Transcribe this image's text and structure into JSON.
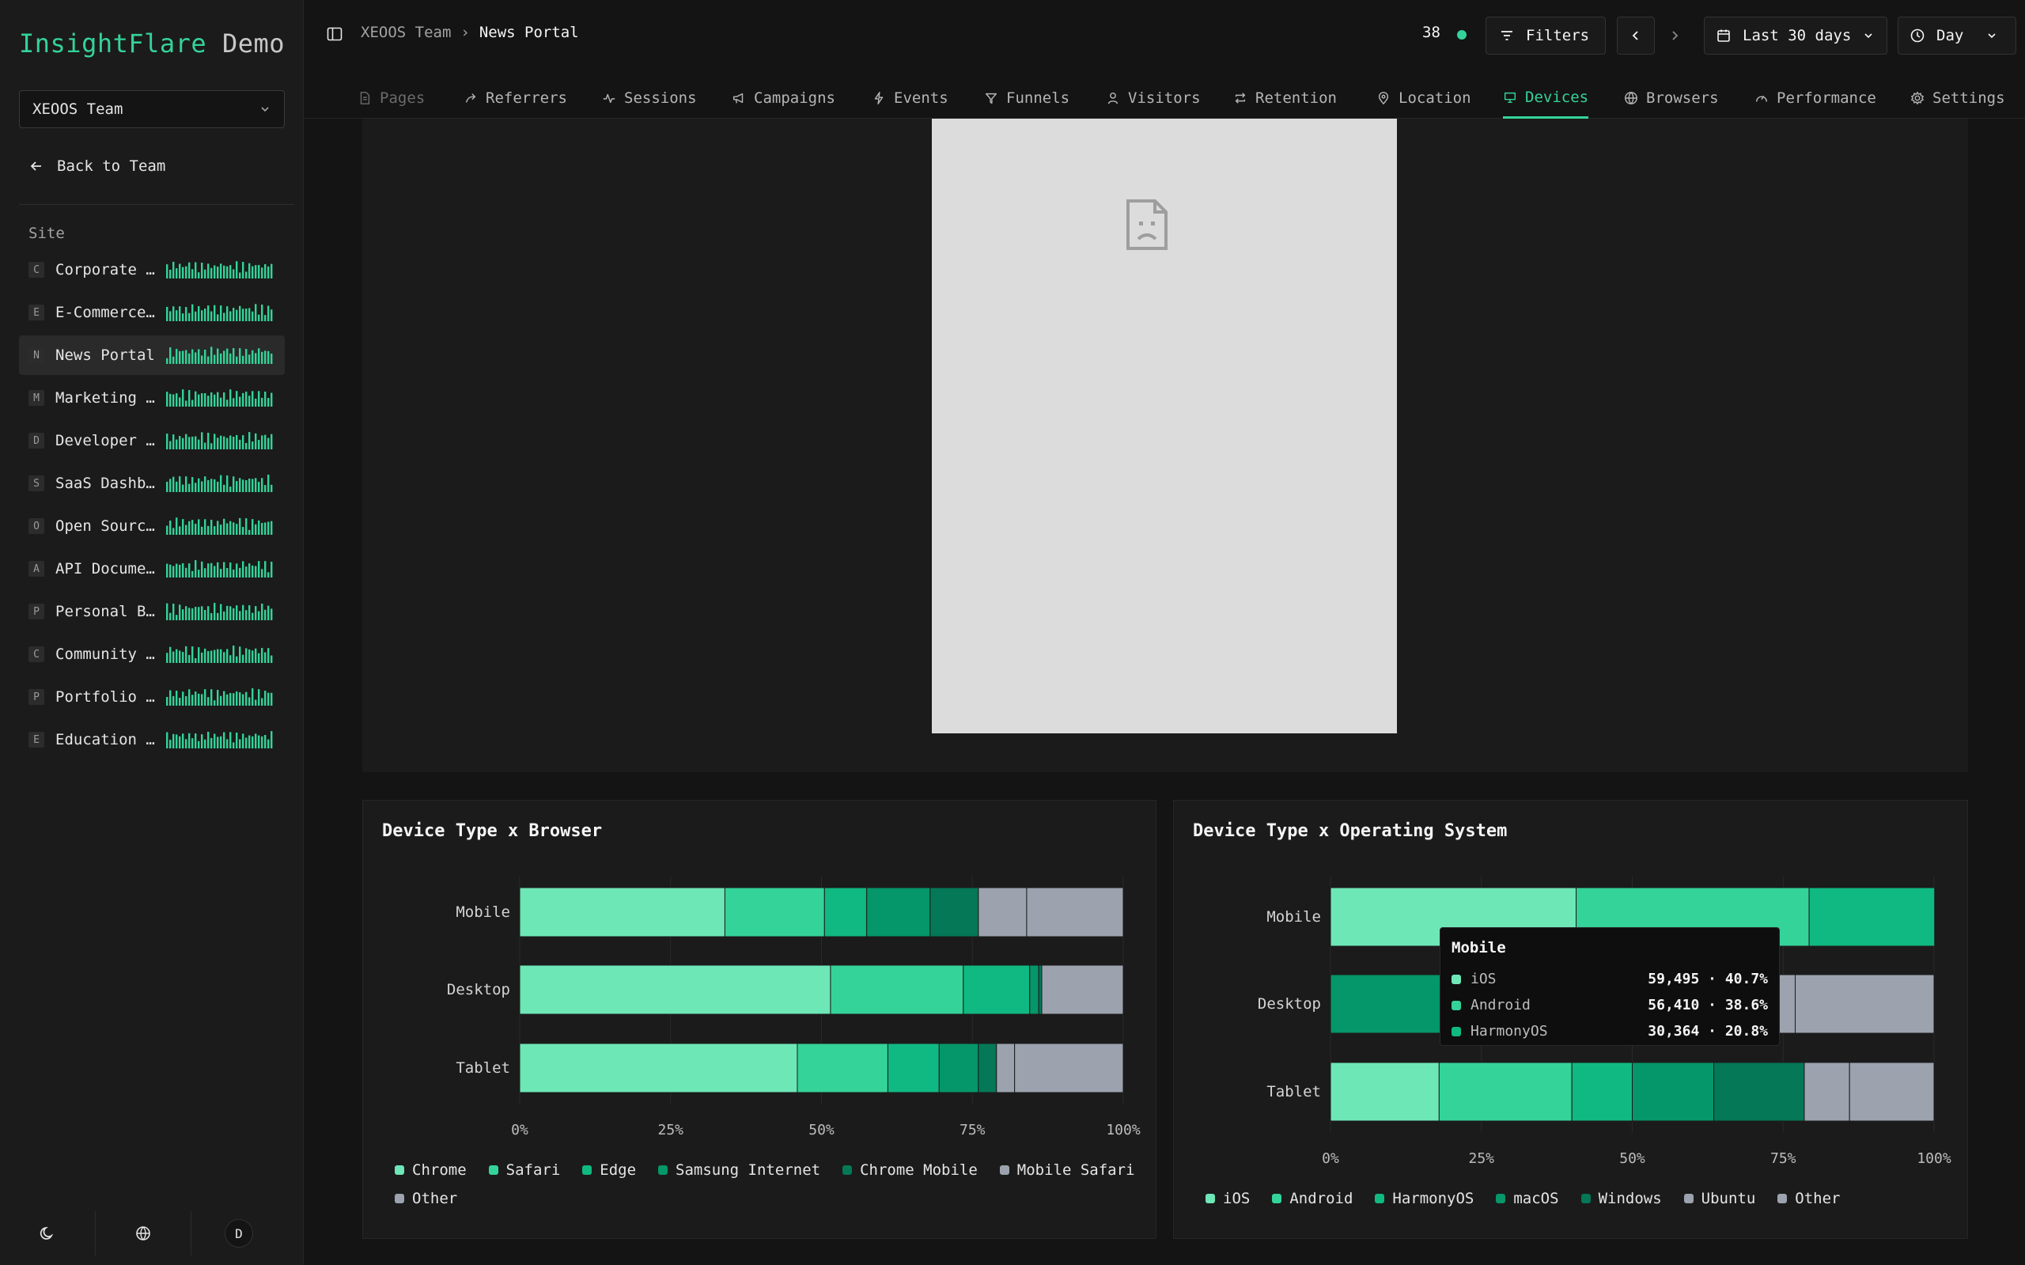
{
  "app": {
    "brand": "InsightFlare",
    "suffix": " Demo"
  },
  "sidebar": {
    "team_select": "XEOOS Team",
    "back_label": "Back to Team",
    "site_heading": "Site",
    "sites": [
      {
        "letter": "C",
        "name": "Corporate Website",
        "active": false
      },
      {
        "letter": "E",
        "name": "E-Commerce Store",
        "active": false
      },
      {
        "letter": "N",
        "name": "News Portal",
        "active": true
      },
      {
        "letter": "M",
        "name": "Marketing Landing",
        "active": false
      },
      {
        "letter": "D",
        "name": "Developer Docs",
        "active": false
      },
      {
        "letter": "S",
        "name": "SaaS Dashboard",
        "active": false
      },
      {
        "letter": "O",
        "name": "Open Source Project",
        "active": false
      },
      {
        "letter": "A",
        "name": "API Documentation",
        "active": false
      },
      {
        "letter": "P",
        "name": "Personal Blog",
        "active": false
      },
      {
        "letter": "C",
        "name": "Community Forum",
        "active": false
      },
      {
        "letter": "P",
        "name": "Portfolio Site",
        "active": false
      },
      {
        "letter": "E",
        "name": "Education Platform",
        "active": false
      }
    ],
    "user_initial": "D"
  },
  "header": {
    "breadcrumb": {
      "parent": "XEOOS Team",
      "separator": "›",
      "current": "News Portal"
    },
    "online_count": "38",
    "filters_label": "Filters",
    "range_label": "Last 30 days",
    "granularity_label": "Day"
  },
  "tabs": [
    {
      "label": "Pages",
      "icon": "file-icon",
      "state": "faded"
    },
    {
      "label": "Referrers",
      "icon": "share-icon",
      "state": "normal"
    },
    {
      "label": "Sessions",
      "icon": "activity-icon",
      "state": "normal"
    },
    {
      "label": "Campaigns",
      "icon": "megaphone-icon",
      "state": "normal"
    },
    {
      "label": "Events",
      "icon": "bolt-icon",
      "state": "normal"
    },
    {
      "label": "Funnels",
      "icon": "funnel-icon",
      "state": "normal"
    },
    {
      "label": "Visitors",
      "icon": "user-icon",
      "state": "normal"
    },
    {
      "label": "Retention",
      "icon": "repeat-icon",
      "state": "normal"
    },
    {
      "label": "Location",
      "icon": "pin-icon",
      "state": "normal"
    },
    {
      "label": "Devices",
      "icon": "monitor-icon",
      "state": "active"
    },
    {
      "label": "Browsers",
      "icon": "globe-icon",
      "state": "normal"
    },
    {
      "label": "Performance",
      "icon": "gauge-icon",
      "state": "normal"
    },
    {
      "label": "Settings",
      "icon": "gear-icon",
      "state": "normal"
    }
  ],
  "colors": {
    "accent": "#34d399",
    "browser": [
      "#6ee7b7",
      "#34d399",
      "#10b981",
      "#059669",
      "#047857",
      "#9ca3af",
      "#9ca3af"
    ],
    "os": [
      "#6ee7b7",
      "#34d399",
      "#10b981",
      "#059669",
      "#047857",
      "#9ca3af",
      "#9ca3af"
    ]
  },
  "chart_data": [
    {
      "type": "bar",
      "orientation": "horizontal-stacked-100",
      "title": "Device Type x Browser",
      "categories": [
        "Mobile",
        "Desktop",
        "Tablet"
      ],
      "series": [
        {
          "name": "Chrome",
          "values": [
            34,
            51.5,
            46
          ]
        },
        {
          "name": "Safari",
          "values": [
            16.5,
            22,
            15
          ]
        },
        {
          "name": "Edge",
          "values": [
            7,
            11,
            8.5
          ]
        },
        {
          "name": "Samsung Internet",
          "values": [
            10.5,
            1.5,
            6.5
          ]
        },
        {
          "name": "Chrome Mobile",
          "values": [
            8,
            0.5,
            3
          ]
        },
        {
          "name": "Mobile Safari",
          "values": [
            8,
            0,
            3
          ]
        },
        {
          "name": "Other",
          "values": [
            16,
            13.5,
            18
          ]
        }
      ],
      "x_ticks": [
        "0%",
        "25%",
        "50%",
        "75%",
        "100%"
      ],
      "xlim": [
        0,
        100
      ],
      "grid": true,
      "legend_position": "bottom"
    },
    {
      "type": "bar",
      "orientation": "horizontal-stacked-100",
      "title": "Device Type x Operating System",
      "categories": [
        "Mobile",
        "Desktop",
        "Tablet"
      ],
      "series": [
        {
          "name": "iOS",
          "values": [
            40.7,
            0,
            18
          ]
        },
        {
          "name": "Android",
          "values": [
            38.6,
            0,
            22
          ]
        },
        {
          "name": "HarmonyOS",
          "values": [
            20.8,
            0,
            10
          ]
        },
        {
          "name": "macOS",
          "values": [
            0,
            25,
            13.5
          ]
        },
        {
          "name": "Windows",
          "values": [
            0,
            45,
            15
          ]
        },
        {
          "name": "Ubuntu",
          "values": [
            0,
            7,
            7.5
          ]
        },
        {
          "name": "Other",
          "values": [
            0,
            23,
            14
          ]
        }
      ],
      "x_ticks": [
        "0%",
        "25%",
        "50%",
        "75%",
        "100%"
      ],
      "xlim": [
        0,
        100
      ],
      "grid": true,
      "legend_position": "bottom"
    }
  ],
  "tooltip": {
    "title": "Mobile",
    "rows": [
      {
        "label": "iOS",
        "value": "59,495 · 40.7%"
      },
      {
        "label": "Android",
        "value": "56,410 · 38.6%"
      },
      {
        "label": "HarmonyOS",
        "value": "30,364 · 20.8%"
      }
    ]
  }
}
